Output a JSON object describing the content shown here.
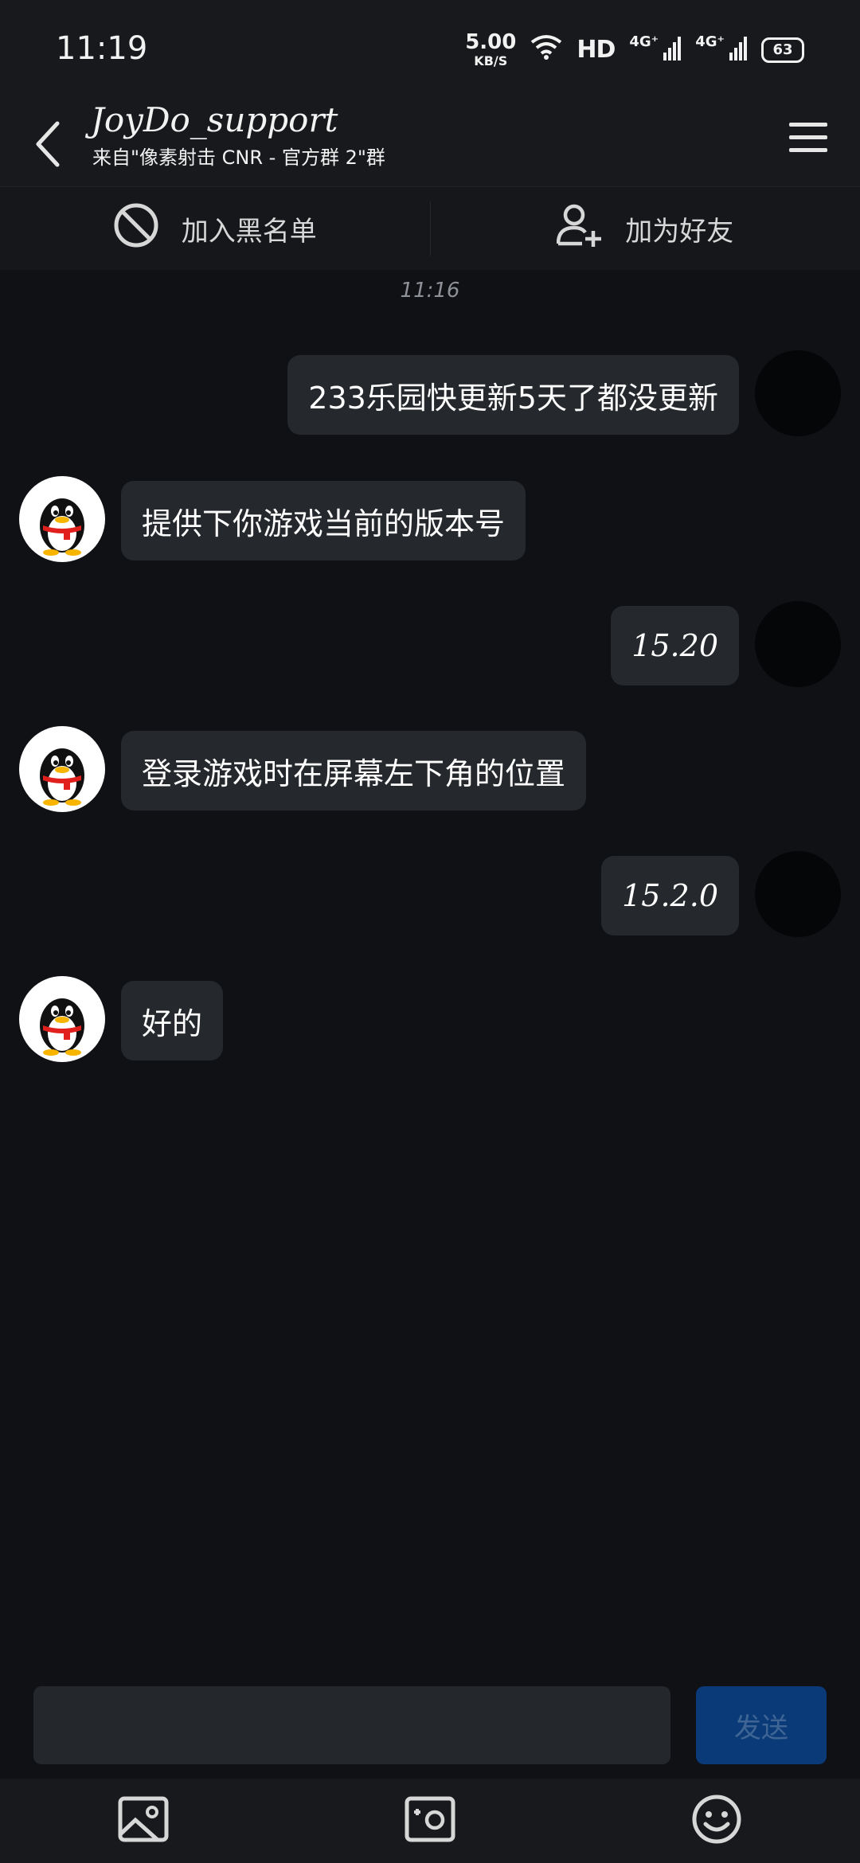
{
  "status_bar": {
    "time": "11:19",
    "net_speed_value": "5.00",
    "net_speed_unit": "KB/S",
    "hd_label": "HD",
    "signal1_label": "4G⁺",
    "signal2_label": "4G⁺",
    "battery": "63"
  },
  "header": {
    "title": "JoyDo_support",
    "subtitle": "来自\"像素射击 CNR - 官方群 2\"群"
  },
  "actions": {
    "blacklist_label": "加入黑名单",
    "add_friend_label": "加为好友"
  },
  "chat": {
    "timestamp": "11:16",
    "messages": [
      {
        "sender": "self",
        "text": "233乐园快更新5天了都没更新"
      },
      {
        "sender": "other",
        "text": "提供下你游戏当前的版本号"
      },
      {
        "sender": "self",
        "text": "15.20"
      },
      {
        "sender": "other",
        "text": "登录游戏时在屏幕左下角的位置"
      },
      {
        "sender": "self",
        "text": "15.2.0"
      },
      {
        "sender": "other",
        "text": "好的"
      }
    ]
  },
  "input": {
    "value": "",
    "placeholder": "",
    "send_label": "发送"
  },
  "toolbar": {
    "icons": [
      "image-icon",
      "camera-icon",
      "emoji-icon"
    ]
  },
  "colors": {
    "background": "#0f1114",
    "bar": "#17191c",
    "bubble": "#25282c",
    "send_button": "#0a3a78"
  }
}
